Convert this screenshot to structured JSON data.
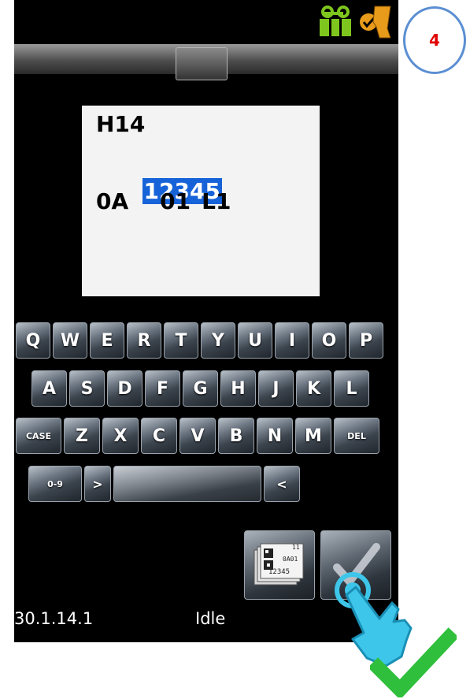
{
  "status_bar": {
    "icons": [
      "battery-icon",
      "scanner-icon"
    ],
    "battery_color": "#7ec61e",
    "scanner_color": "#e89a1a"
  },
  "label_preview": {
    "line1": "H14",
    "line2": "12345",
    "line3_a": "0A",
    "line3_b": "01",
    "line3_c": "L1"
  },
  "keyboard": {
    "row1": [
      "Q",
      "W",
      "E",
      "R",
      "T",
      "Y",
      "U",
      "I",
      "O",
      "P"
    ],
    "row2": [
      "A",
      "S",
      "D",
      "F",
      "G",
      "H",
      "J",
      "K",
      "L"
    ],
    "row3_left": "CASE",
    "row3": [
      "Z",
      "X",
      "C",
      "V",
      "B",
      "N",
      "M"
    ],
    "row3_right": "DEL",
    "row4_numbers": "0-9",
    "row4_right_arrow": ">",
    "row4_left_arrow": "<"
  },
  "actions": {
    "label_thumb_text_1": "11",
    "label_thumb_text_2": "0A01",
    "label_thumb_text_3": "12345"
  },
  "footer": {
    "version": "30.1.14.1",
    "status": "Idle"
  },
  "step_number": "4",
  "colors": {
    "highlight": "#1662d8",
    "step_ring": "#5b8fd2",
    "step_text": "#e00000",
    "hand": "#3ec6ea",
    "check": "#2fbf3c"
  }
}
